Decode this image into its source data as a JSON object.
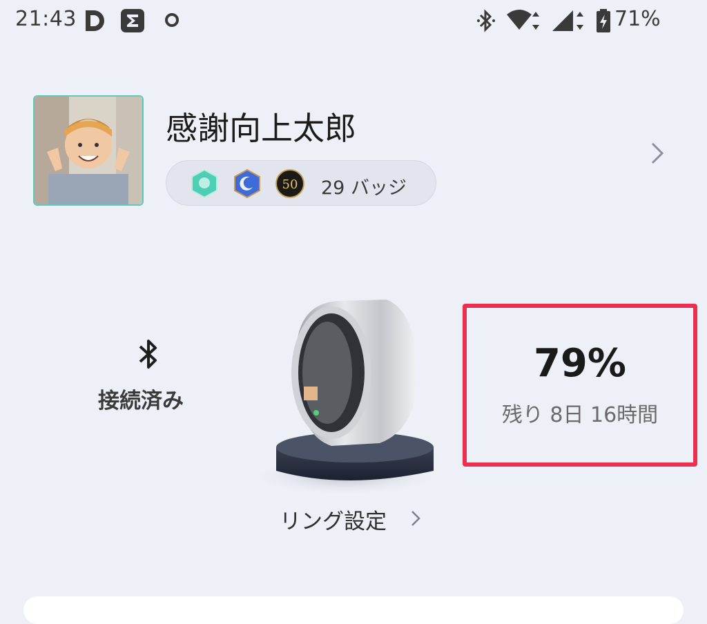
{
  "status_bar": {
    "time": "21:43",
    "battery_percent": "71%",
    "icons": [
      "d-app-icon",
      "sigma-app-icon",
      "sync-icon",
      "bluetooth-icon",
      "wifi-icon",
      "signal-icon",
      "battery-charging-icon"
    ]
  },
  "profile": {
    "name": "感謝向上太郎",
    "badges": {
      "count_label": "29 バッジ",
      "icons": [
        "teal-hexagon-badge-icon",
        "moon-hexagon-badge-icon",
        "fifty-circle-badge-icon"
      ],
      "fifty_text": "50"
    }
  },
  "connection": {
    "status_label": "接続済み"
  },
  "ring": {
    "settings_label": "リング設定"
  },
  "battery": {
    "percent": "79%",
    "remaining": "残り 8日 16時間",
    "level": 0.79
  },
  "colors": {
    "background": "#eef0f7",
    "highlight_border": "#ea2f4f",
    "avatar_border": "#5fc9b8"
  }
}
